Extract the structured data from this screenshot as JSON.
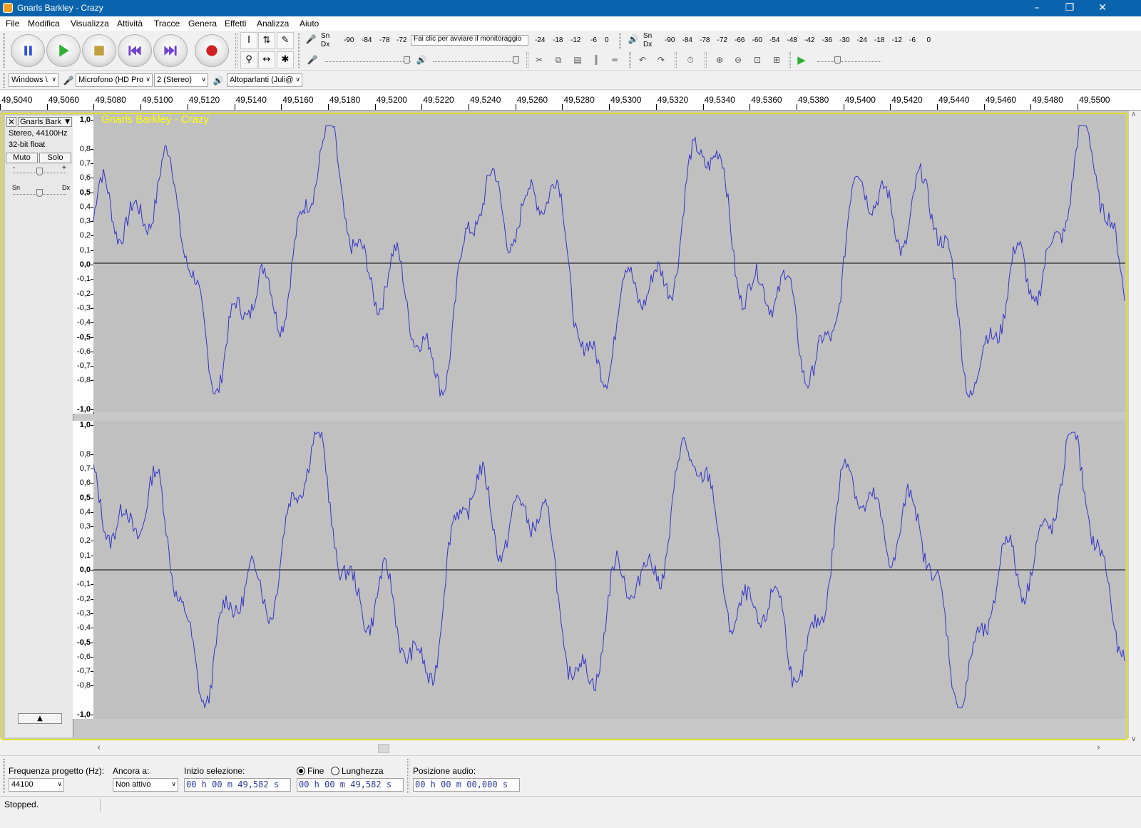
{
  "window": {
    "title": "Gnarls Barkley - Crazy"
  },
  "menu": [
    "File",
    "Modifica",
    "Visualizza",
    "Attività",
    "Tracce",
    "Genera",
    "Effetti",
    "Analizza",
    "Aiuto"
  ],
  "meters": {
    "record_ticks": [
      "-90",
      "-84",
      "-78",
      "-72",
      "-24",
      "-18",
      "-12",
      "-6",
      "0"
    ],
    "monitor_prompt": "Fai clic per avviare il monitoraggio",
    "playback_ticks": [
      "-90",
      "-84",
      "-78",
      "-72",
      "-66",
      "-60",
      "-54",
      "-48",
      "-42",
      "-36",
      "-30",
      "-24",
      "-18",
      "-12",
      "-6",
      "0"
    ],
    "left_label": "Sn",
    "right_label": "Dx"
  },
  "devices": {
    "host": "Windows \\",
    "input": "Microfono (HD Pro",
    "channels": "2 (Stereo)",
    "output": "Altoparlanti (Juli@"
  },
  "ruler_labels": [
    "49,5040",
    "49,5060",
    "49,5080",
    "49,5100",
    "49,5120",
    "49,5140",
    "49,5160",
    "49,5180",
    "49,5200",
    "49,5220",
    "49,5240",
    "49,5260",
    "49,5280",
    "49,5300",
    "49,5320",
    "49,5340",
    "49,5360",
    "49,5380",
    "49,5400",
    "49,5420",
    "49,5440",
    "49,5460",
    "49,5480",
    "49,5500"
  ],
  "track": {
    "name": "Gnarls Bark",
    "clip_name": "Gnarls Barkley - Crazy",
    "format": "Stereo, 44100Hz",
    "bit_depth": "32-bit float",
    "mute_label": "Muto",
    "solo_label": "Solo",
    "gain_minus": "-",
    "gain_plus": "+",
    "pan_left": "Sn",
    "pan_right": "Dx"
  },
  "amplitude_labels": [
    "1,0",
    "0,8",
    "0,7",
    "0,6",
    "0,5",
    "0,4",
    "0,3",
    "0,2",
    "0,1",
    "0,0",
    "-0,1",
    "-0,2",
    "-0,3",
    "-0,4",
    "-0,5",
    "-0,6",
    "-0,7",
    "-0,8",
    "-1,0"
  ],
  "selection": {
    "rate_label": "Frequenza progetto (Hz):",
    "rate_value": "44100",
    "snap_label": "Ancora a:",
    "snap_value": "Non attivo",
    "start_label": "Inizio selezione:",
    "start_value": "00 h 00 m 49,582 s",
    "end_option": "Fine",
    "length_option": "Lunghezza",
    "end_value": "00 h 00 m 49,582 s",
    "position_label": "Posizione audio:",
    "position_value": "00 h 00 m 00,000 s"
  },
  "status": "Stopped.",
  "colors": {
    "titlebar": "#0a64ad",
    "waveform": "#3232c8",
    "track_bg": "#c0c0c0",
    "clip_name": "#ffff00",
    "selected_border": "#e0e020"
  }
}
